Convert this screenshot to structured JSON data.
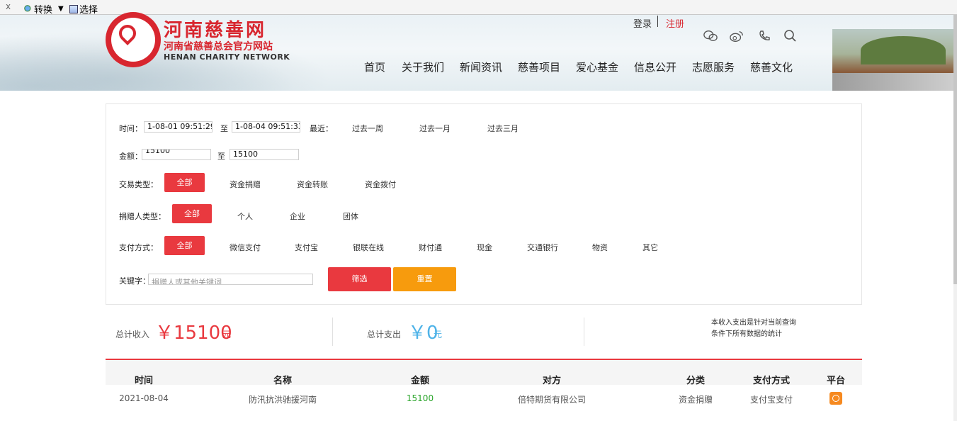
{
  "toolbar": {
    "close": "x",
    "convert_label": "转换",
    "caret": "▼",
    "select_label": "选择"
  },
  "header": {
    "logo_title": "河南慈善网",
    "logo_subtitle": "河南省慈善总会官方网站",
    "logo_english": "HENAN CHARITY NETWORK",
    "login": "登录",
    "register": "注册",
    "icons": [
      "wechat-icon",
      "weibo-icon",
      "phone-icon",
      "search-icon"
    ],
    "nav": [
      "首页",
      "关于我们",
      "新闻资讯",
      "慈善项目",
      "爱心基金",
      "信息公开",
      "志愿服务",
      "慈善文化"
    ]
  },
  "filter": {
    "time_label": "时间：",
    "time_from": "1-08-01 09:51:29",
    "to_label": "至",
    "time_to": "1-08-04 09:51:33",
    "recent_label": "最近：",
    "recent_options": [
      "过去一周",
      "过去一月",
      "过去三月"
    ],
    "amount_label": "金额：",
    "amount_from": "15100",
    "amount_to": "15100",
    "txn_type_label": "交易类型：",
    "txn_types": [
      "全部",
      "资金捐赠",
      "资金转账",
      "资金拨付"
    ],
    "donor_type_label": "捐赠人类型：",
    "donor_types": [
      "全部",
      "个人",
      "企业",
      "团体"
    ],
    "pay_method_label": "支付方式：",
    "pay_methods": [
      "全部",
      "微信支付",
      "支付宝",
      "银联在线",
      "财付通",
      "现金",
      "交通银行",
      "物资",
      "其它"
    ],
    "keyword_label": "关键字：",
    "keyword_placeholder": "捐赠人或其他关键词",
    "filter_button": "筛选",
    "reset_button": "重置"
  },
  "totals": {
    "income_label": "总计收入",
    "income_value": "￥15100",
    "income_unit": "元",
    "expense_label": "总计支出",
    "expense_value": "￥0",
    "expense_unit": "元",
    "note_line1": "本收入支出是针对当前查询",
    "note_line2": "条件下所有数据的统计"
  },
  "table": {
    "headers": [
      "时间",
      "名称",
      "金额",
      "对方",
      "分类",
      "支付方式",
      "平台"
    ],
    "rows": [
      [
        "2021-08-04",
        "防汛抗洪驰援河南",
        "15100",
        "倍特期货有限公司",
        "资金捐赠",
        "支付宝支付",
        "alipay-icon"
      ]
    ]
  },
  "colors": {
    "brand_red": "#d8262f",
    "button_red": "#e9393f",
    "button_orange": "#f79b0d",
    "expense_blue": "#4fb3e8",
    "amount_green": "#2aa52a"
  }
}
